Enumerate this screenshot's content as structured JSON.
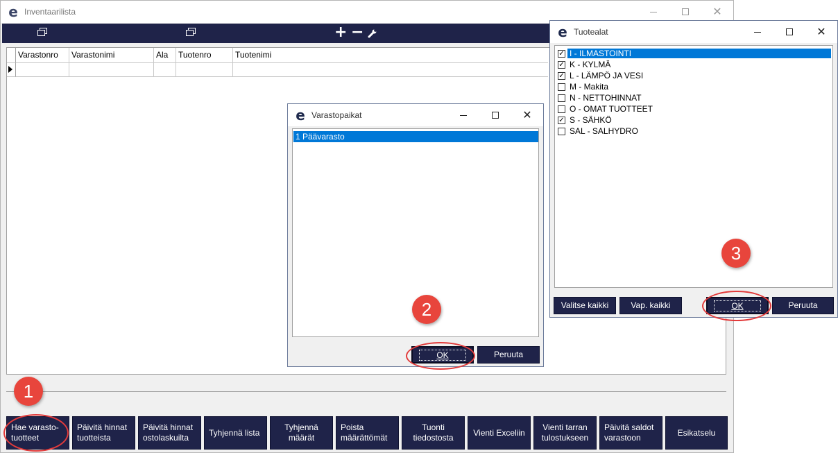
{
  "main_window": {
    "title": "Inventaarilista",
    "toolbar_glyphs": {
      "add": "+",
      "remove": "−"
    },
    "grid": {
      "columns": [
        "Varastonro",
        "Varastonimi",
        "Ala",
        "Tuotenro",
        "Tuotenimi"
      ],
      "rows": [
        [
          "",
          "",
          "",
          "",
          ""
        ]
      ]
    },
    "buttons": [
      "Hae varasto-\ntuotteet",
      "Päivitä hinnat\ntuotteista",
      "Päivitä hinnat\nostolaskuilta",
      "Tyhjennä lista",
      "Tyhjennä\nmäärät",
      "Poista\nmäärättömät",
      "Tuonti\ntiedostosta",
      "Vienti Exceliin",
      "Vienti tarran\ntulostukseen",
      "Päivitä saldot\nvarastoon",
      "Esikatselu"
    ]
  },
  "varastopaikat_dialog": {
    "title": "Varastopaikat",
    "items": [
      "1 Päävarasto"
    ],
    "ok_label": "OK",
    "cancel_label": "Peruuta"
  },
  "tuotealat_dialog": {
    "title": "Tuotealat",
    "items": [
      {
        "label": "I - ILMASTOINTI",
        "checked": true
      },
      {
        "label": "K - KYLMÄ",
        "checked": true
      },
      {
        "label": "L - LÄMPÖ JA VESI",
        "checked": true
      },
      {
        "label": "M - Makita",
        "checked": false
      },
      {
        "label": "N - NETTOHINNAT",
        "checked": false
      },
      {
        "label": "O - OMAT TUOTTEET",
        "checked": false
      },
      {
        "label": "S - SÄHKÖ",
        "checked": true
      },
      {
        "label": "SAL - SALHYDRO",
        "checked": false
      }
    ],
    "select_all_label": "Valitse kaikki",
    "deselect_all_label": "Vap. kaikki",
    "ok_label": "OK",
    "cancel_label": "Peruuta"
  },
  "annotations": [
    "1",
    "2",
    "3"
  ],
  "colors": {
    "navy": "#1f2349",
    "selection": "#0078d7",
    "annotation_red": "#e8453c"
  }
}
